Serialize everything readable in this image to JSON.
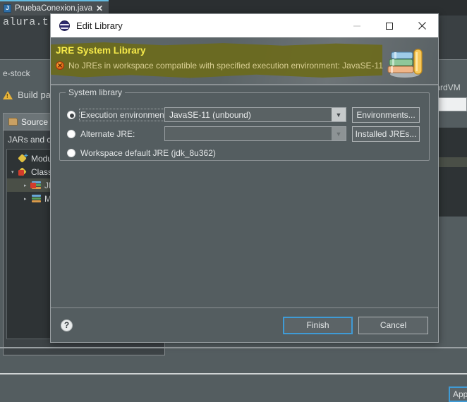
{
  "ide": {
    "editor_tab": {
      "label": "PruebaConexion.java",
      "icon": "java-file-icon",
      "close": "✕",
      "file_letter": "J"
    },
    "code_line": "alura.t",
    "background_dialog": {
      "breadcrumb": "e-stock",
      "page_title": "Build path",
      "warning_icon": "warning-triangle-icon",
      "tab_source": "Source",
      "panel_label": "JARs and cla",
      "tree_items": [
        {
          "label": "Modu",
          "icon": "modulepath-icon",
          "twisty": "",
          "indent": 1,
          "selected": false
        },
        {
          "label": "Class",
          "icon": "classpath-error-icon",
          "twisty": "▾",
          "indent": 1,
          "selected": false
        },
        {
          "label": "JR",
          "icon": "jre-library-error-icon",
          "twisty": "▸",
          "indent": 2,
          "selected": true
        },
        {
          "label": "M",
          "icon": "library-icon",
          "twisty": "▸",
          "indent": 2,
          "selected": false
        }
      ],
      "right_clipped_text": "ndardVM",
      "apply_button": "App"
    }
  },
  "dialog": {
    "title": "Edit Library",
    "app_icon": "eclipse-globe-icon",
    "window_controls": {
      "minimize": "minimize-icon",
      "maximize": "maximize-icon",
      "close": "close-icon"
    },
    "header": {
      "title": "JRE System Library",
      "message": "No JREs in workspace compatible with specified execution environment: JavaSE-11",
      "message_icon": "error-icon",
      "banner_icon": "books-icon",
      "highlight_color": "#6b6a1c",
      "title_color": "#f5e94a"
    },
    "group": {
      "legend": "System library",
      "options": [
        {
          "label_pre": "E",
          "label_mnemonic": "x",
          "label_post": "ecution environment:",
          "label_full": "Execution environment:",
          "selected": true,
          "focused": true,
          "combo_value": "JavaSE-11 (unbound)",
          "combo_enabled": true,
          "button": "Environments...",
          "button_mnemonic": "o"
        },
        {
          "label_full": "Alternate JRE:",
          "selected": false,
          "focused": false,
          "combo_value": "",
          "combo_enabled": false,
          "button": "Installed JREs...",
          "button_mnemonic": "I"
        },
        {
          "label_full": "Workspace default JRE (jdk_8u362)",
          "selected": false,
          "focused": false
        }
      ]
    },
    "footer": {
      "help": "?",
      "finish": "Finish",
      "cancel": "Cancel"
    }
  }
}
